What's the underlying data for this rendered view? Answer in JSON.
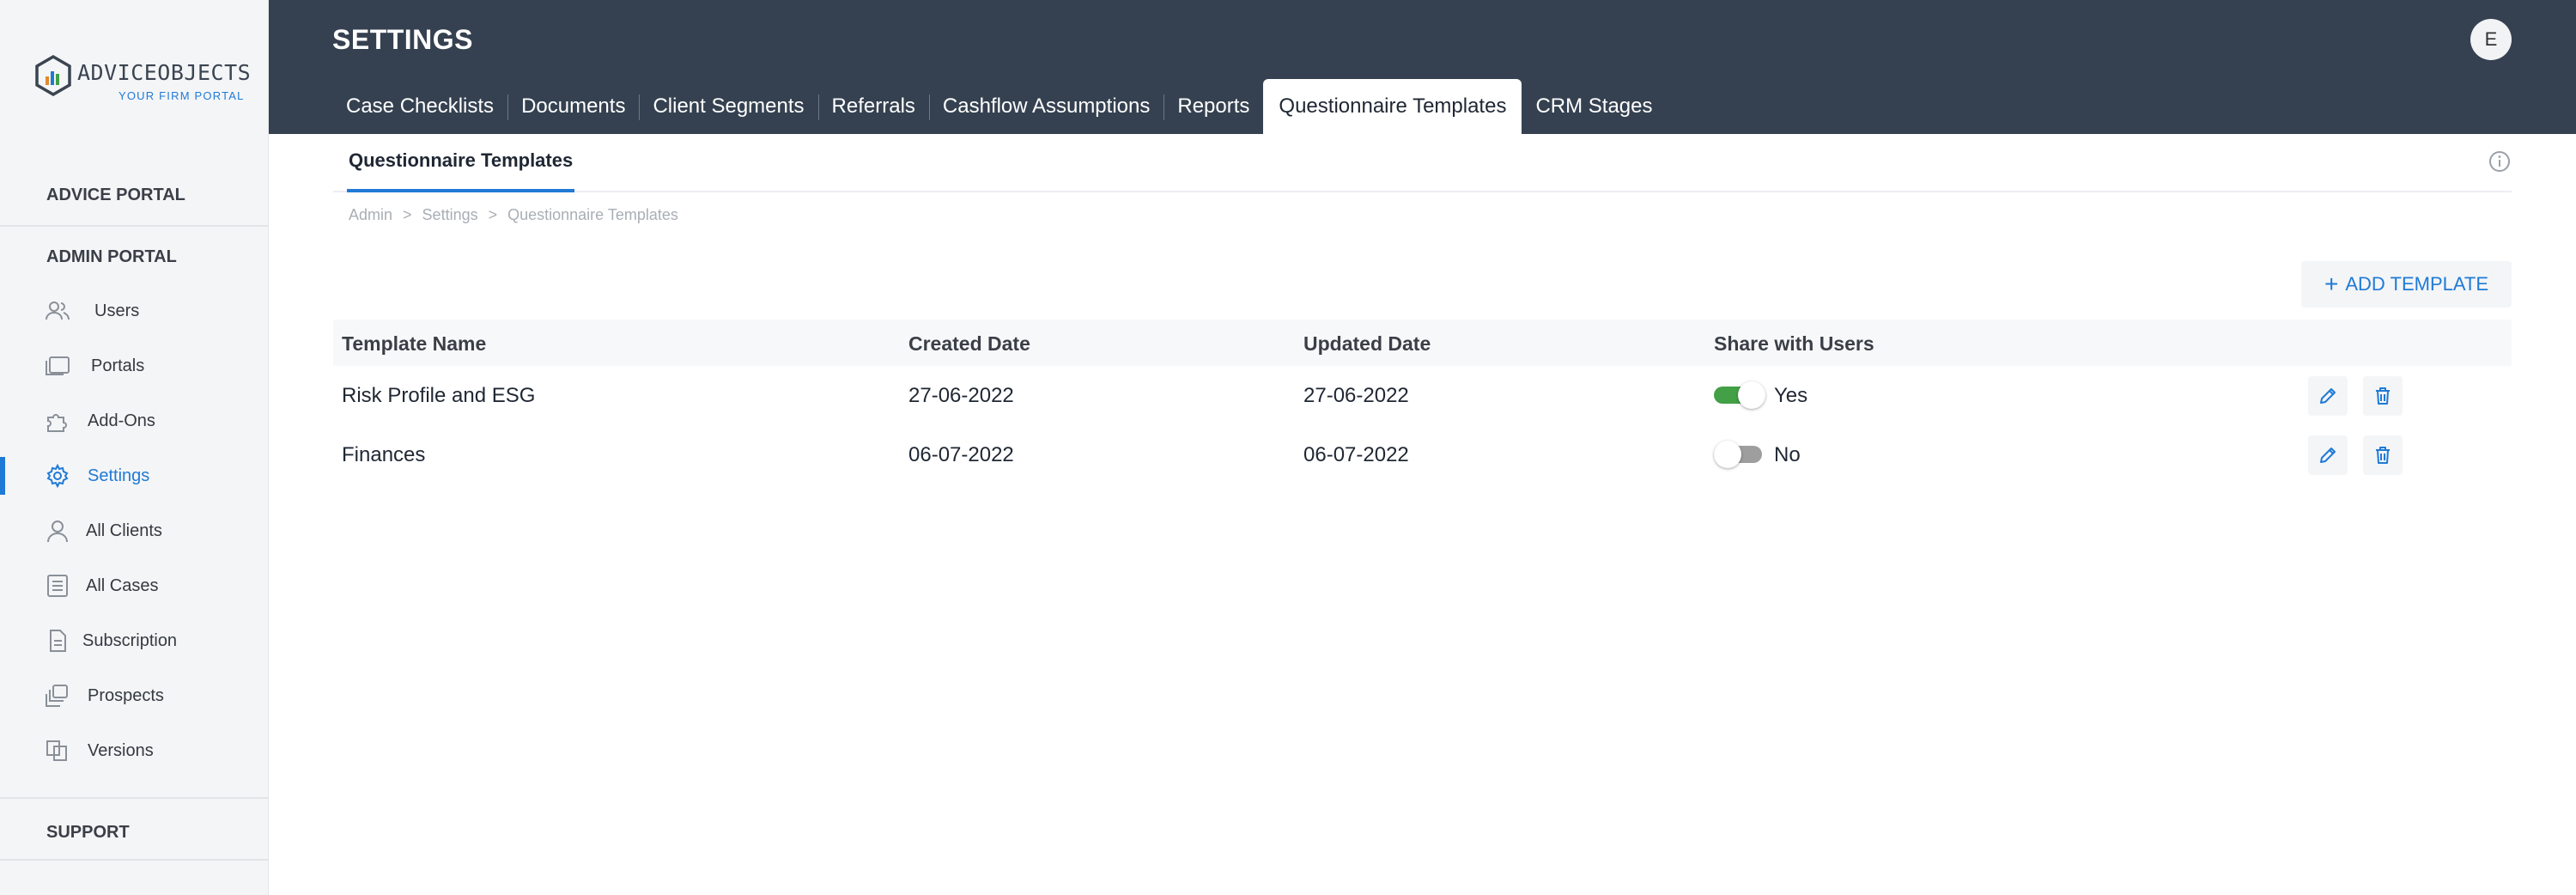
{
  "brand": {
    "name": "ADVICEOBJECTS",
    "tagline": "YOUR FIRM PORTAL"
  },
  "sidebar": {
    "sections": {
      "advice_portal": "ADVICE PORTAL",
      "admin_portal": "ADMIN PORTAL",
      "support": "SUPPORT"
    },
    "items": [
      {
        "label": "Users",
        "icon": "users-icon"
      },
      {
        "label": "Portals",
        "icon": "portals-icon"
      },
      {
        "label": "Add-Ons",
        "icon": "puzzle-icon"
      },
      {
        "label": "Settings",
        "icon": "gear-icon",
        "active": true
      },
      {
        "label": "All Clients",
        "icon": "user-icon"
      },
      {
        "label": "All Cases",
        "icon": "list-icon"
      },
      {
        "label": "Subscription",
        "icon": "document-icon"
      },
      {
        "label": "Prospects",
        "icon": "stack-icon"
      },
      {
        "label": "Versions",
        "icon": "versions-icon"
      }
    ]
  },
  "header": {
    "title": "SETTINGS",
    "avatar_initial": "E",
    "tabs": [
      {
        "label": "Case Checklists"
      },
      {
        "label": "Documents"
      },
      {
        "label": "Client Segments"
      },
      {
        "label": "Referrals"
      },
      {
        "label": "Cashflow Assumptions"
      },
      {
        "label": "Reports"
      },
      {
        "label": "Questionnaire Templates",
        "active": true
      },
      {
        "label": "CRM Stages"
      }
    ]
  },
  "subtab": {
    "label": "Questionnaire Templates"
  },
  "breadcrumb": [
    "Admin",
    ">",
    "Settings",
    ">",
    "Questionnaire Templates"
  ],
  "add_button": {
    "label": "ADD TEMPLATE",
    "icon": "plus-icon"
  },
  "table": {
    "columns": [
      "Template Name",
      "Created Date",
      "Updated Date",
      "Share with Users"
    ],
    "rows": [
      {
        "name": "Risk Profile and ESG",
        "created": "27-06-2022",
        "updated": "27-06-2022",
        "shared": true,
        "share_label": "Yes"
      },
      {
        "name": "Finances",
        "created": "06-07-2022",
        "updated": "06-07-2022",
        "shared": false,
        "share_label": "No"
      }
    ]
  },
  "colors": {
    "header_bg": "#354150",
    "accent": "#1f7ad6",
    "toggle_on": "#43a047",
    "toggle_off": "#9e9e9e",
    "sidebar_bg": "#f4f5f7"
  }
}
